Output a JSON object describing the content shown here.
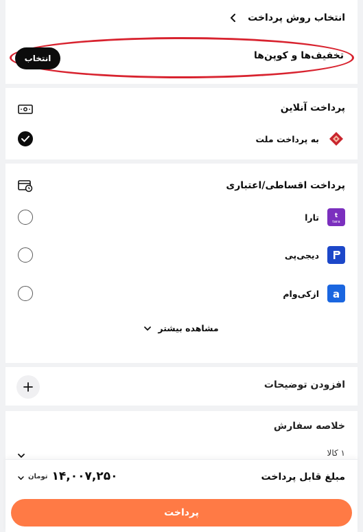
{
  "header": {
    "title": "انتخاب روش پرداخت"
  },
  "coupons": {
    "label": "تخفیف‌ها و کوپن‌ها",
    "button_label": "انتخاب"
  },
  "online": {
    "heading": "پرداخت آنلاین",
    "options": [
      {
        "name": "به پرداخت ملت",
        "selected": true
      }
    ]
  },
  "installment": {
    "heading": "پرداخت اقساطی/اعتباری",
    "options": [
      {
        "name": "تارا",
        "logo_text": "tara",
        "selected": false
      },
      {
        "name": "دیجی‌پی",
        "logo_text": "P",
        "selected": false
      },
      {
        "name": "ازکی‌وام",
        "logo_text": "a",
        "selected": false
      }
    ],
    "more_label": "مشاهده بیشتر"
  },
  "notes": {
    "label": "افزودن توضیحات"
  },
  "summary": {
    "title": "خلاصه سفارش",
    "items_count": "۱ کالا",
    "payable_label": "مبلغ قابل پرداخت",
    "amount": "۱۴,۰۰۷,۲۵۰",
    "currency": "تومان",
    "pay_button": "پرداخت"
  },
  "colors": {
    "accent": "#ff7a45",
    "highlight_ring": "#d8232f",
    "tara": "#7b2fbe",
    "digipay": "#1c47c9",
    "azki": "#1a66e0",
    "mellat": "#c9262e"
  }
}
